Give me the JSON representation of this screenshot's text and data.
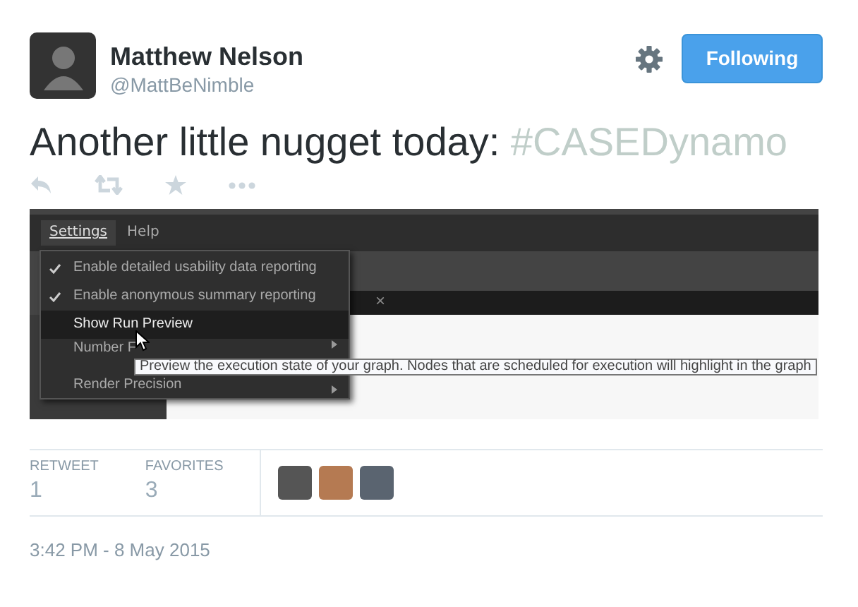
{
  "author": {
    "name": "Matthew Nelson",
    "handle": "@MattBeNimble"
  },
  "follow_button": {
    "label": "Following"
  },
  "tweet": {
    "text": "Another little nugget today: ",
    "hashtag": "#CASEDynamo"
  },
  "embedded_screenshot": {
    "menubar": [
      {
        "label": "Settings",
        "selected": true
      },
      {
        "label": "Help",
        "selected": false
      }
    ],
    "menu": [
      {
        "label": "Enable detailed usability data reporting",
        "checked": true,
        "highlighted": false,
        "kind": "toggle"
      },
      {
        "label": "Enable anonymous summary reporting",
        "checked": true,
        "highlighted": false,
        "kind": "toggle"
      },
      {
        "label": "Show Run Preview",
        "checked": false,
        "highlighted": true,
        "kind": "toggle"
      },
      {
        "label": "Number F",
        "checked": false,
        "highlighted": false,
        "kind": "submenu"
      },
      {
        "label": "Render Precision",
        "checked": false,
        "highlighted": false,
        "kind": "submenu"
      }
    ],
    "tab_close": "×",
    "tooltip": "Preview the execution state of your graph. Nodes that are scheduled for execution will highlight in the graph"
  },
  "stats": [
    {
      "label": "RETWEET",
      "value": "1"
    },
    {
      "label": "FAVORITES",
      "value": "3"
    }
  ],
  "timestamp": "3:42 PM - 8 May 2015"
}
